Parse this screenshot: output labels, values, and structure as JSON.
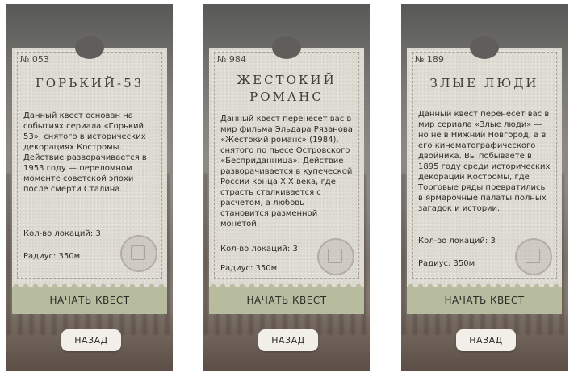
{
  "quests": [
    {
      "number": "№ 053",
      "title": "ГОРЬКИЙ-53",
      "description": "Данный квест основан на событиях сериала «Горький 53», снятого в исторических декорациях Костромы. Действие разворачивается в 1953 году — переломном моменте советской эпохи после смерти Сталина.",
      "locations": "Кол-во локаций: 3",
      "radius": "Радиус: 350м",
      "start_label": "НАЧАТЬ КВЕСТ",
      "back_label": "НАЗАД"
    },
    {
      "number": "№ 984",
      "title": "ЖЕСТОКИЙ РОМАНС",
      "description": "Данный квест перенесет вас в мир фильма Эльдара Рязанова «Жестокий романс» (1984), снятого по пьесе Островского «Бесприданница». Действие разворачивается в купеческой России конца XIX века, где страсть сталкивается с расчетом, а любовь становится разменной монетой.",
      "locations": "Кол-во локаций: 3",
      "radius": "Радиус: 350м",
      "start_label": "НАЧАТЬ КВЕСТ",
      "back_label": "НАЗАД"
    },
    {
      "number": "№ 189",
      "title": "ЗЛЫЕ ЛЮДИ",
      "description": "Данный квест перенесет вас в мир сериала «Злые люди» — но не в Нижний Новгород, а в его кинематографического двойника. Вы побываете в 1895 году среди исторических декораций Костромы, где Торговые ряды превратились в ярмарочные палаты полных загадок и истории.",
      "locations": "Кол-во локаций: 3",
      "radius": "Радиус: 350м",
      "start_label": "НАЧАТЬ КВЕСТ",
      "back_label": "НАЗАД"
    }
  ],
  "colors": {
    "card": "#dedbd3",
    "start_button": "#b8bc9e",
    "back_button": "#f2efe8"
  },
  "icons": {
    "seal": "seal-stamp-icon"
  }
}
